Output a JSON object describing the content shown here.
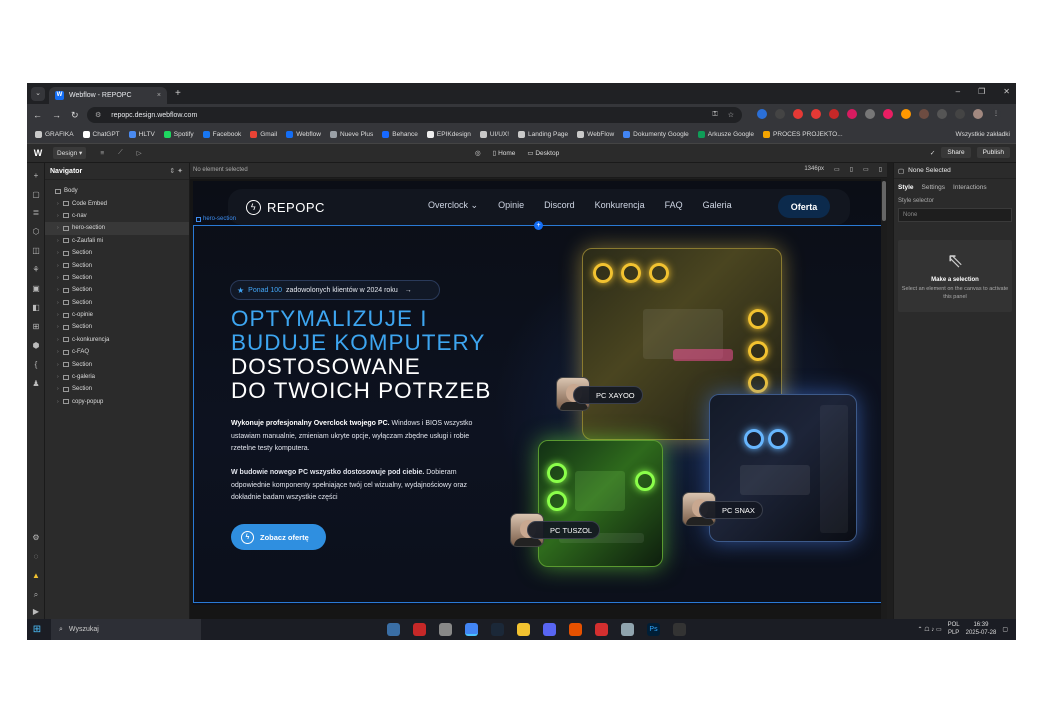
{
  "browser": {
    "tab_title": "Webflow - REPOPC",
    "tab_close": "×",
    "new_tab": "+",
    "url": "repopc.design.webflow.com",
    "window_controls": [
      "–",
      "❐",
      "✕"
    ]
  },
  "bookmarks": [
    {
      "label": "GRAFIKA",
      "color": "#c9c9c9"
    },
    {
      "label": "ChatGPT",
      "color": "#ffffff"
    },
    {
      "label": "HLTV",
      "color": "#4a8af0"
    },
    {
      "label": "Spotify",
      "color": "#1ed760"
    },
    {
      "label": "Facebook",
      "color": "#1877f2"
    },
    {
      "label": "Gmail",
      "color": "#ea4335"
    },
    {
      "label": "Webflow",
      "color": "#146ef5"
    },
    {
      "label": "Nueve Plus",
      "color": "#9aa0a6"
    },
    {
      "label": "Behance",
      "color": "#1769ff"
    },
    {
      "label": "EPIKdesign",
      "color": "#eeeeee"
    },
    {
      "label": "UI/UX!",
      "color": "#c9c9c9"
    },
    {
      "label": "Landing Page",
      "color": "#c9c9c9"
    },
    {
      "label": "WebFlow",
      "color": "#c9c9c9"
    },
    {
      "label": "Dokumenty Google",
      "color": "#4285f4"
    },
    {
      "label": "Arkusze Google",
      "color": "#0f9d58"
    },
    {
      "label": "PROCES PROJEKTO...",
      "color": "#f4a400"
    }
  ],
  "bookmarks_all": "Wszystkie zakładki",
  "webflow_toolbar": {
    "logo": "W",
    "mode": "Design",
    "page": "Home",
    "breakpoint": "Desktop",
    "share": "Share",
    "publish": "Publish"
  },
  "navigator": {
    "title": "Navigator",
    "items": [
      {
        "label": "Body",
        "indent": 0,
        "selected": false
      },
      {
        "label": "Code Embed",
        "indent": 1,
        "selected": false
      },
      {
        "label": "c-nav",
        "indent": 1,
        "selected": false
      },
      {
        "label": "hero-section",
        "indent": 1,
        "selected": true
      },
      {
        "label": "c-Zaufali mi",
        "indent": 1,
        "selected": false
      },
      {
        "label": "Section",
        "indent": 1,
        "selected": false
      },
      {
        "label": "Section",
        "indent": 1,
        "selected": false
      },
      {
        "label": "Section",
        "indent": 1,
        "selected": false
      },
      {
        "label": "Section",
        "indent": 1,
        "selected": false
      },
      {
        "label": "Section",
        "indent": 1,
        "selected": false
      },
      {
        "label": "c-opinie",
        "indent": 1,
        "selected": false
      },
      {
        "label": "Section",
        "indent": 1,
        "selected": false
      },
      {
        "label": "c-konkurencja",
        "indent": 1,
        "selected": false
      },
      {
        "label": "c-FAQ",
        "indent": 1,
        "selected": false
      },
      {
        "label": "Section",
        "indent": 1,
        "selected": false
      },
      {
        "label": "c-galeria",
        "indent": 1,
        "selected": false
      },
      {
        "label": "Section",
        "indent": 1,
        "selected": false
      },
      {
        "label": "copy-popup",
        "indent": 1,
        "selected": false
      }
    ]
  },
  "canvas": {
    "status": "No element selected",
    "width_readout": "1346px",
    "selected_label": "hero-section"
  },
  "site": {
    "brand": "REPOPC",
    "nav_links": [
      "Overclock",
      "Opinie",
      "Discord",
      "Konkurencja",
      "FAQ",
      "Galeria"
    ],
    "cta_nav": "Oferta",
    "badge": {
      "highlight": "Ponad 100",
      "text": "zadowolonych klientów w 2024 roku"
    },
    "title_blue": [
      "OPTYMALIZUJE I",
      "BUDUJE KOMPUTERY"
    ],
    "title_white": [
      "DOSTOSOWANE",
      "DO TWOICH POTRZEB"
    ],
    "para1_bold": "Wykonuje profesjonalny Overclock twojego PC.",
    "para1_rest": "Windows i BIOS wszystko ustawiam manualnie, zmieniam ukryte opcje, wyłączam zbędne usługi i robie rzetelne testy komputera.",
    "para2_bold": "W budowie nowego PC wszystko dostosowuje pod ciebie.",
    "para2_rest": "Dobieram odpowiednie komponenty spełniające twój cel wizualny, wydajnościowy oraz dokładnie badam wszystkie części",
    "cta": "Zobacz ofertę",
    "pc_tags": [
      {
        "prefix": "PC",
        "name": "XAYOO"
      },
      {
        "prefix": "PC",
        "name": "TUSZOL"
      },
      {
        "prefix": "PC",
        "name": "SNAX"
      }
    ]
  },
  "right_panel": {
    "title": "None Selected",
    "tabs": [
      "Style",
      "Settings",
      "Interactions"
    ],
    "style_selector_label": "Style selector",
    "style_selector_value": "None",
    "empty_title": "Make a selection",
    "empty_sub": "Select an element on the canvas to activate this panel"
  },
  "taskbar": {
    "search": "Wyszukaj",
    "lang_top": "POL",
    "lang_bottom": "PLP",
    "time": "16:39",
    "date": "2025-07-28"
  },
  "colors": {
    "accent_blue": "#3da5f0",
    "webflow_blue": "#146ef5",
    "selection_outline": "#2a7ad5"
  }
}
